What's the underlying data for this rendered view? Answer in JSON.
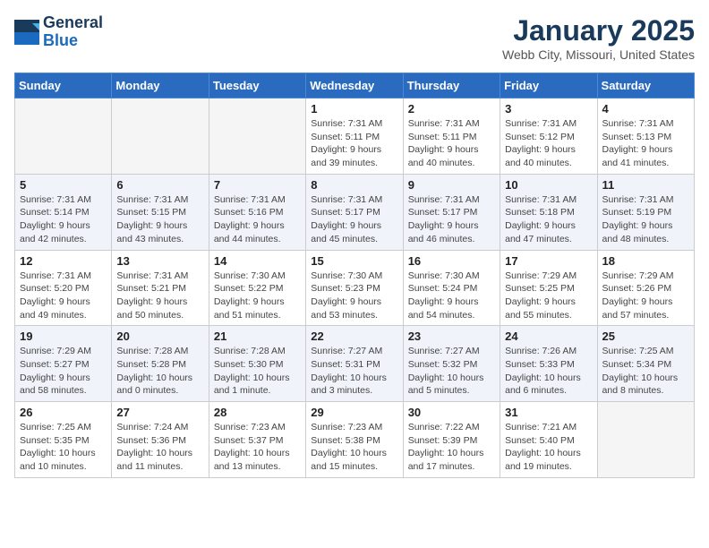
{
  "header": {
    "logo_line1": "General",
    "logo_line2": "Blue",
    "month": "January 2025",
    "location": "Webb City, Missouri, United States"
  },
  "weekdays": [
    "Sunday",
    "Monday",
    "Tuesday",
    "Wednesday",
    "Thursday",
    "Friday",
    "Saturday"
  ],
  "weeks": [
    [
      {
        "day": "",
        "info": ""
      },
      {
        "day": "",
        "info": ""
      },
      {
        "day": "",
        "info": ""
      },
      {
        "day": "1",
        "info": "Sunrise: 7:31 AM\nSunset: 5:11 PM\nDaylight: 9 hours\nand 39 minutes."
      },
      {
        "day": "2",
        "info": "Sunrise: 7:31 AM\nSunset: 5:11 PM\nDaylight: 9 hours\nand 40 minutes."
      },
      {
        "day": "3",
        "info": "Sunrise: 7:31 AM\nSunset: 5:12 PM\nDaylight: 9 hours\nand 40 minutes."
      },
      {
        "day": "4",
        "info": "Sunrise: 7:31 AM\nSunset: 5:13 PM\nDaylight: 9 hours\nand 41 minutes."
      }
    ],
    [
      {
        "day": "5",
        "info": "Sunrise: 7:31 AM\nSunset: 5:14 PM\nDaylight: 9 hours\nand 42 minutes."
      },
      {
        "day": "6",
        "info": "Sunrise: 7:31 AM\nSunset: 5:15 PM\nDaylight: 9 hours\nand 43 minutes."
      },
      {
        "day": "7",
        "info": "Sunrise: 7:31 AM\nSunset: 5:16 PM\nDaylight: 9 hours\nand 44 minutes."
      },
      {
        "day": "8",
        "info": "Sunrise: 7:31 AM\nSunset: 5:17 PM\nDaylight: 9 hours\nand 45 minutes."
      },
      {
        "day": "9",
        "info": "Sunrise: 7:31 AM\nSunset: 5:17 PM\nDaylight: 9 hours\nand 46 minutes."
      },
      {
        "day": "10",
        "info": "Sunrise: 7:31 AM\nSunset: 5:18 PM\nDaylight: 9 hours\nand 47 minutes."
      },
      {
        "day": "11",
        "info": "Sunrise: 7:31 AM\nSunset: 5:19 PM\nDaylight: 9 hours\nand 48 minutes."
      }
    ],
    [
      {
        "day": "12",
        "info": "Sunrise: 7:31 AM\nSunset: 5:20 PM\nDaylight: 9 hours\nand 49 minutes."
      },
      {
        "day": "13",
        "info": "Sunrise: 7:31 AM\nSunset: 5:21 PM\nDaylight: 9 hours\nand 50 minutes."
      },
      {
        "day": "14",
        "info": "Sunrise: 7:30 AM\nSunset: 5:22 PM\nDaylight: 9 hours\nand 51 minutes."
      },
      {
        "day": "15",
        "info": "Sunrise: 7:30 AM\nSunset: 5:23 PM\nDaylight: 9 hours\nand 53 minutes."
      },
      {
        "day": "16",
        "info": "Sunrise: 7:30 AM\nSunset: 5:24 PM\nDaylight: 9 hours\nand 54 minutes."
      },
      {
        "day": "17",
        "info": "Sunrise: 7:29 AM\nSunset: 5:25 PM\nDaylight: 9 hours\nand 55 minutes."
      },
      {
        "day": "18",
        "info": "Sunrise: 7:29 AM\nSunset: 5:26 PM\nDaylight: 9 hours\nand 57 minutes."
      }
    ],
    [
      {
        "day": "19",
        "info": "Sunrise: 7:29 AM\nSunset: 5:27 PM\nDaylight: 9 hours\nand 58 minutes."
      },
      {
        "day": "20",
        "info": "Sunrise: 7:28 AM\nSunset: 5:28 PM\nDaylight: 10 hours\nand 0 minutes."
      },
      {
        "day": "21",
        "info": "Sunrise: 7:28 AM\nSunset: 5:30 PM\nDaylight: 10 hours\nand 1 minute."
      },
      {
        "day": "22",
        "info": "Sunrise: 7:27 AM\nSunset: 5:31 PM\nDaylight: 10 hours\nand 3 minutes."
      },
      {
        "day": "23",
        "info": "Sunrise: 7:27 AM\nSunset: 5:32 PM\nDaylight: 10 hours\nand 5 minutes."
      },
      {
        "day": "24",
        "info": "Sunrise: 7:26 AM\nSunset: 5:33 PM\nDaylight: 10 hours\nand 6 minutes."
      },
      {
        "day": "25",
        "info": "Sunrise: 7:25 AM\nSunset: 5:34 PM\nDaylight: 10 hours\nand 8 minutes."
      }
    ],
    [
      {
        "day": "26",
        "info": "Sunrise: 7:25 AM\nSunset: 5:35 PM\nDaylight: 10 hours\nand 10 minutes."
      },
      {
        "day": "27",
        "info": "Sunrise: 7:24 AM\nSunset: 5:36 PM\nDaylight: 10 hours\nand 11 minutes."
      },
      {
        "day": "28",
        "info": "Sunrise: 7:23 AM\nSunset: 5:37 PM\nDaylight: 10 hours\nand 13 minutes."
      },
      {
        "day": "29",
        "info": "Sunrise: 7:23 AM\nSunset: 5:38 PM\nDaylight: 10 hours\nand 15 minutes."
      },
      {
        "day": "30",
        "info": "Sunrise: 7:22 AM\nSunset: 5:39 PM\nDaylight: 10 hours\nand 17 minutes."
      },
      {
        "day": "31",
        "info": "Sunrise: 7:21 AM\nSunset: 5:40 PM\nDaylight: 10 hours\nand 19 minutes."
      },
      {
        "day": "",
        "info": ""
      }
    ]
  ]
}
